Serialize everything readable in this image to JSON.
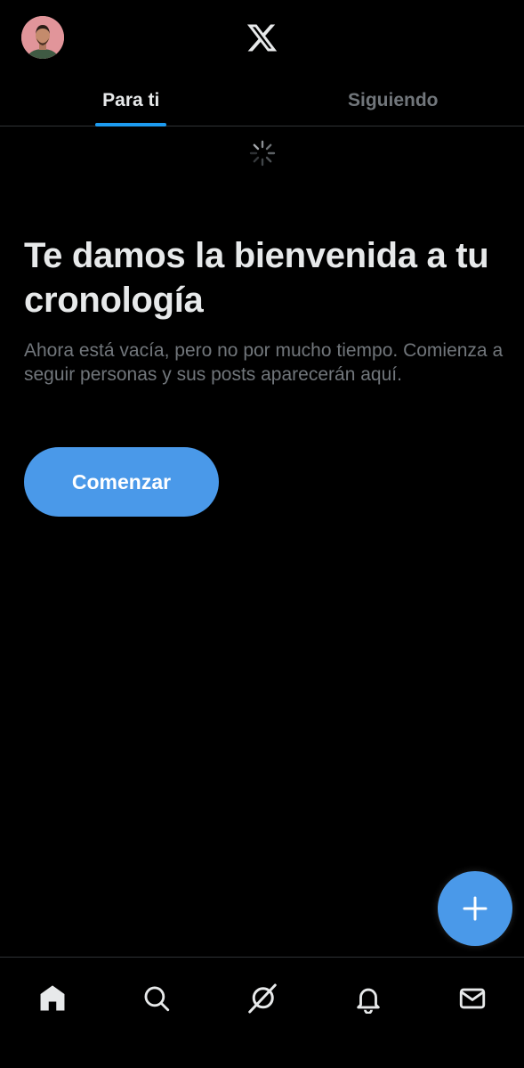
{
  "header": {
    "avatar_icon": "user-avatar",
    "logo_icon": "x-logo-icon"
  },
  "tabs": [
    {
      "label": "Para ti",
      "active": true
    },
    {
      "label": "Siguiendo",
      "active": false
    }
  ],
  "empty_state": {
    "title": "Te damos la bienvenida a tu cronología",
    "description": "Ahora está vacía, pero no por mucho tiempo. Comienza a seguir personas y sus posts aparecerán aquí.",
    "button_label": "Comenzar"
  },
  "fab": {
    "icon": "plus-icon"
  },
  "bottom_nav": [
    {
      "name": "home",
      "icon": "home-icon"
    },
    {
      "name": "search",
      "icon": "search-icon"
    },
    {
      "name": "grok",
      "icon": "grok-icon"
    },
    {
      "name": "notifications",
      "icon": "bell-icon"
    },
    {
      "name": "messages",
      "icon": "mail-icon"
    }
  ],
  "colors": {
    "background": "#000000",
    "accent": "#1d9bf0",
    "button": "#4a99e9",
    "text_primary": "#e7e9ea",
    "text_secondary": "#71767b",
    "border": "#2f3336"
  }
}
